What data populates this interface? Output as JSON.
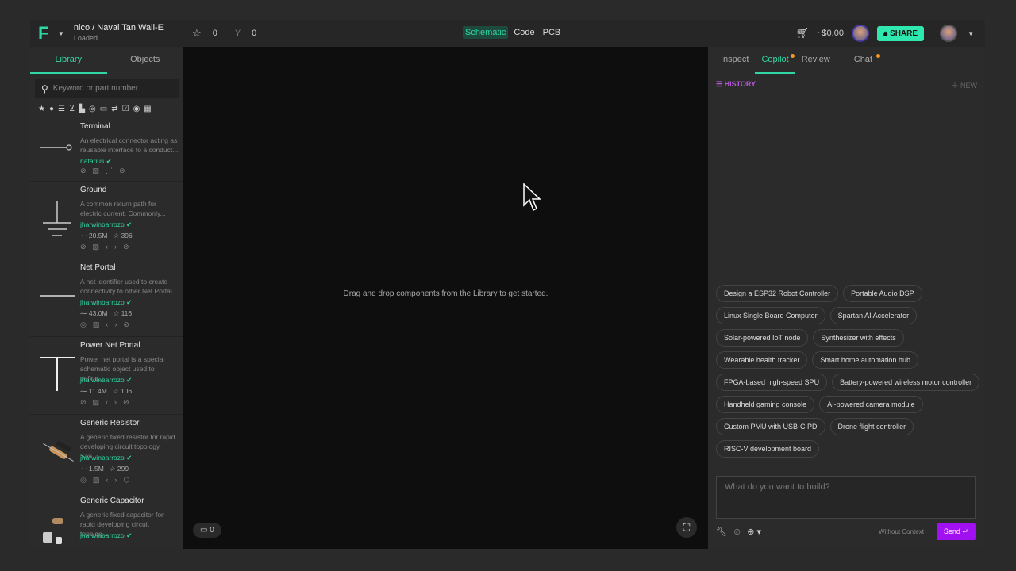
{
  "header": {
    "project": "nico / Naval Tan Wall-E",
    "status": "Loaded",
    "stars": "0",
    "forks": "0",
    "views": [
      "Schematic",
      "Code",
      "PCB"
    ],
    "active_view": "Schematic",
    "cost": "~$0.00",
    "share": "SHARE"
  },
  "left": {
    "tabs": [
      "Library",
      "Objects"
    ],
    "search_placeholder": "Keyword or part number",
    "items": [
      {
        "name": "Terminal",
        "desc": "An electrical connector acting as reusable interface to a conduct...",
        "author": "natarius",
        "uses": "",
        "stars": ""
      },
      {
        "name": "Ground",
        "desc": "A common return path for electric current. Commonly...",
        "author": "jharwinbarrozo",
        "uses": "20.5M",
        "stars": "396"
      },
      {
        "name": "Net Portal",
        "desc": "A net identifier used to create connectivity to other Net Portal...",
        "author": "jharwinbarrozo",
        "uses": "43.0M",
        "stars": "116"
      },
      {
        "name": "Power Net Portal",
        "desc": "Power net portal is a special schematic object used to define...",
        "author": "jharwinbarrozo",
        "uses": "11.4M",
        "stars": "106"
      },
      {
        "name": "Generic Resistor",
        "desc": "A generic fixed resistor for rapid developing circuit topology. Sav...",
        "author": "jharwinbarrozo",
        "uses": "1.5M",
        "stars": "299"
      },
      {
        "name": "Generic Capacitor",
        "desc": "A generic fixed capacitor for rapid developing circuit topolog...",
        "author": "jharwinbarrozo",
        "uses": "",
        "stars": ""
      }
    ]
  },
  "canvas": {
    "hint": "Drag and drop components from the Library to get started.",
    "comments": "0"
  },
  "right": {
    "tabs": [
      "Inspect",
      "Copilot",
      "Review",
      "Chat"
    ],
    "history": "HISTORY",
    "new": "NEW",
    "suggestions": [
      "Design a ESP32 Robot Controller",
      "Portable Audio DSP",
      "Linux Single Board Computer",
      "Spartan AI Accelerator",
      "Solar-powered IoT node",
      "Synthesizer with effects",
      "Wearable health tracker",
      "Smart home automation hub",
      "FPGA-based high-speed SPU",
      "Battery-powered wireless motor controller",
      "Handheld gaming console",
      "AI-powered camera module",
      "Custom PMU with USB-C PD",
      "Drone flight controller",
      "RISC-V development board"
    ],
    "input_placeholder": "What do you want to build?",
    "context": "Without Context",
    "send": "Send"
  },
  "colors": {
    "accent": "#2fd7a4",
    "purple": "#a010f0"
  }
}
